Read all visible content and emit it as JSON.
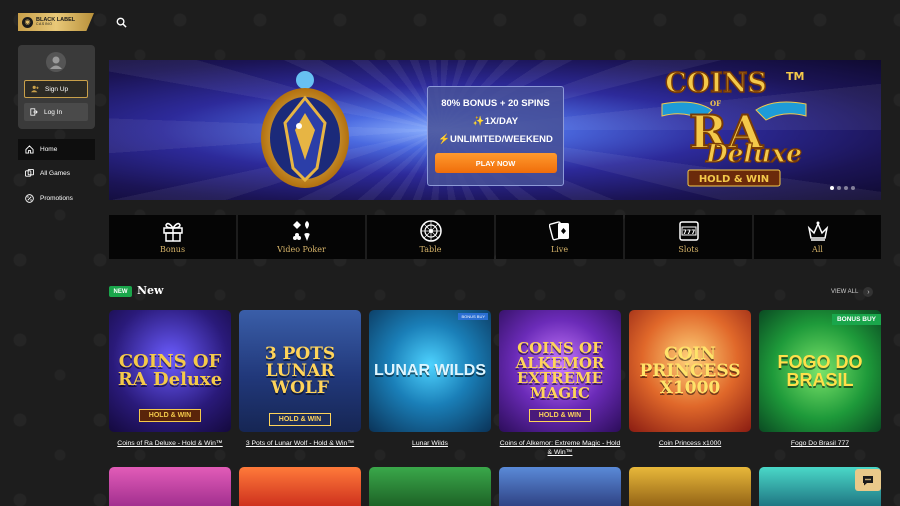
{
  "brand": {
    "logo_line1": "BLACK LABEL",
    "logo_line2": "CASINO",
    "accent": "#c9a04a"
  },
  "header": {
    "search_icon": "search-icon"
  },
  "sidebar": {
    "signup_label": "Sign Up",
    "login_label": "Log In",
    "nav": [
      {
        "label": "Home",
        "icon": "home-icon",
        "active": true
      },
      {
        "label": "All Games",
        "icon": "dice-icon",
        "active": false
      },
      {
        "label": "Promotions",
        "icon": "percent-icon",
        "active": false
      }
    ]
  },
  "banner": {
    "promo_line1": "80% BONUS + 20 SPINS",
    "promo_line2": "✨1X/DAY",
    "promo_line3": "⚡UNLIMITED/WEEKEND",
    "cta": "PLAY NOW",
    "game_title_1": "COINS",
    "game_title_of": "OF",
    "game_title_2": "RA",
    "game_title_3": "Deluxe",
    "game_title_tm": "TM",
    "game_title_sub": "HOLD & WIN",
    "slide_count": 4,
    "active_slide": 1
  },
  "categories": [
    {
      "label": "Bonus",
      "icon": "gift-icon"
    },
    {
      "label": "Video Poker",
      "icon": "card-suits-icon"
    },
    {
      "label": "Table",
      "icon": "roulette-icon"
    },
    {
      "label": "Live",
      "icon": "playing-cards-icon"
    },
    {
      "label": "Slots",
      "icon": "slot-machine-icon"
    },
    {
      "label": "All",
      "icon": "crown-icon"
    }
  ],
  "new_section": {
    "badge": "NEW",
    "title": "New",
    "view_all": "VIEW ALL",
    "games": [
      {
        "name": "Coins of Ra Deluxe - Hold & Win™",
        "art": "COINS OF RA Deluxe",
        "sub": "HOLD & WIN"
      },
      {
        "name": "3 Pots of Lunar Wolf - Hold & Win™",
        "art": "3 POTS LUNAR WOLF",
        "sub": "HOLD & WIN"
      },
      {
        "name": "Lunar Wilds",
        "art": "LUNAR WILDS",
        "badge": "BONUS BUY"
      },
      {
        "name": "Coins of Alkemor: Extreme Magic - Hold & Win™",
        "art": "COINS OF ALKEMOR EXTREME MAGIC",
        "sub": "HOLD & WIN"
      },
      {
        "name": "Coin Princess x1000",
        "art": "COIN PRINCESS X1000"
      },
      {
        "name": "Fogo Do Brasil 777",
        "art": "FOGO DO BRASIL",
        "badge": "BONUS BUY"
      }
    ]
  },
  "chat": {
    "icon": "chat-icon"
  }
}
